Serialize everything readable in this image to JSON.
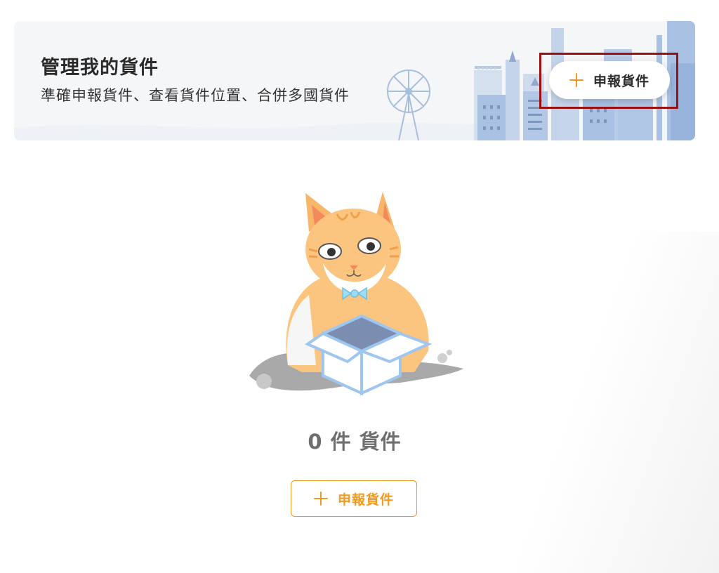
{
  "banner": {
    "title": "管理我的貨件",
    "subtitle": "準確申報貨件、查看貨件位置、合併多國貨件",
    "action_label": "申報貨件",
    "action_icon": "plus-icon"
  },
  "empty_state": {
    "illustration": "cat-in-box-illustration",
    "count_text": "0 件 貨件",
    "action_label": "申報貨件",
    "action_icon": "plus-icon"
  },
  "colors": {
    "accent": "#f29a1f",
    "highlight": "#9b1010",
    "banner_bg": "#f5f6f8",
    "city": "#a9c2e3"
  }
}
